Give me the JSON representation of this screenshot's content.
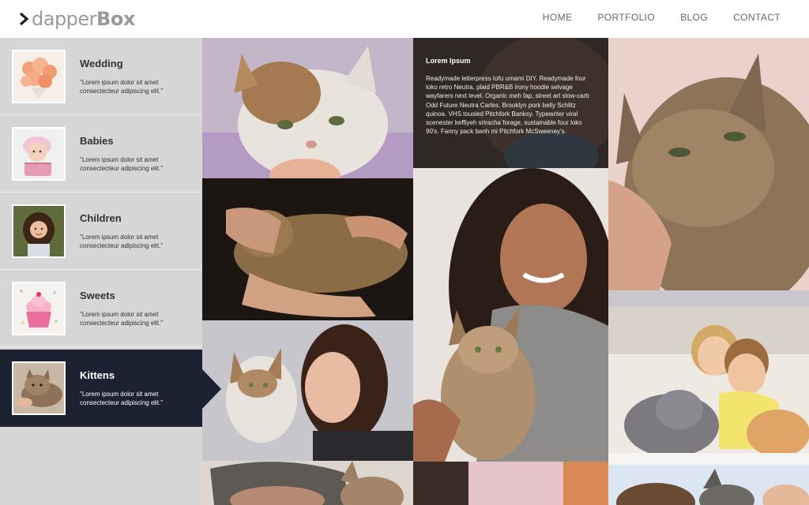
{
  "header": {
    "logo_light": "dapper",
    "logo_bold": "Box",
    "nav": [
      "HOME",
      "PORTFOLIO",
      "BLOG",
      "CONTACT"
    ]
  },
  "sidebar": {
    "items": [
      {
        "title": "Wedding",
        "desc": "\"Lorem ipsum dolor sit amet consectecteur adipiscing elit.\"",
        "icon": "flower-bouquet-image"
      },
      {
        "title": "Babies",
        "desc": "\"Lorem ipsum dolor sit amet consectecteur adipiscing elit.\"",
        "icon": "baby-image"
      },
      {
        "title": "Children",
        "desc": "\"Lorem ipsum dolor sit amet consectecteur adipiscing elit.\"",
        "icon": "child-image"
      },
      {
        "title": "Sweets",
        "desc": "\"Lorem ipsum dolor sit amet consectecteur adipiscing elit.\"",
        "icon": "cupcake-image"
      },
      {
        "title": "Kittens",
        "desc": "\"Lorem ipsum dolor sit amet consectecteur adipiscing elit.\"",
        "icon": "kitten-image"
      }
    ],
    "active_index": 4
  },
  "overlay": {
    "title": "Lorem Ipsum",
    "text": "Readymade letterpress tofu umami DIY. Readymade four loko retro Neutra, plaid PBR&B irony hoodie selvage wayfarers next level. Organic meh fap, street art slow-carb Odd Future Neutra Carles. Brooklyn pork belly Schlitz quinoa. VHS tousled Pitchfork Banksy. Typewriter viral scenester keffiyeh sriracha forage, sustainable four loko 90's. Fanny pack banh mi Pitchfork McSweeney's."
  },
  "colors": {
    "sidebar_bg": "#d6d6d6",
    "active_bg": "#1d2233",
    "logo_gray": "#9a9a9a"
  }
}
